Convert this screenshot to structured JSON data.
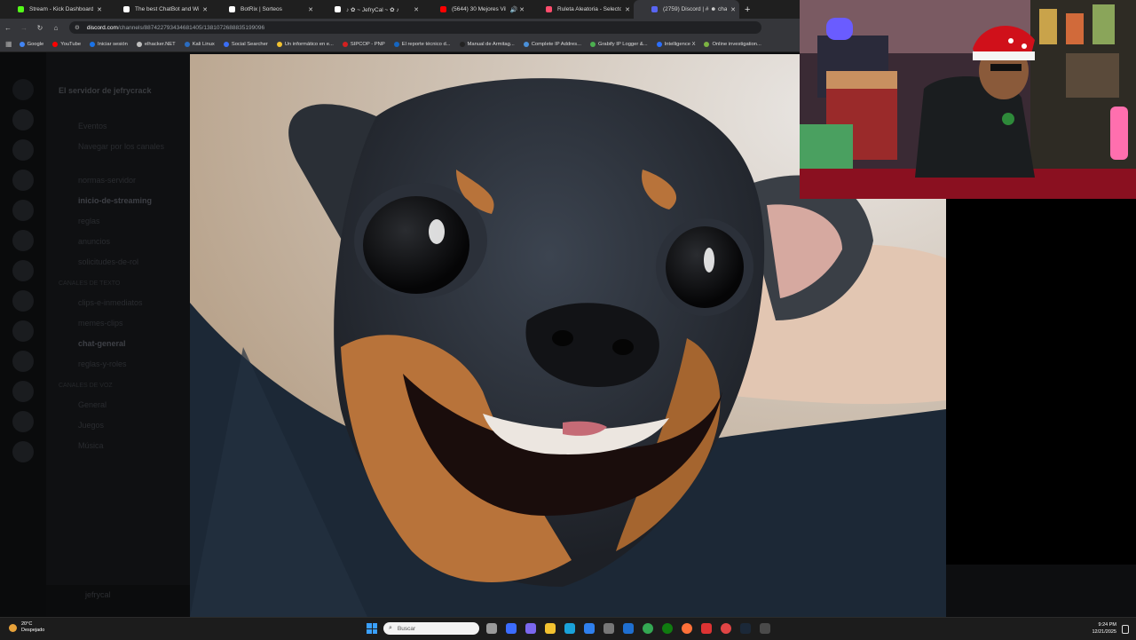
{
  "browser": {
    "tabs": [
      {
        "title": "Stream - Kick Dashboard",
        "color": "#53fc18",
        "active": false
      },
      {
        "title": "The best ChatBot and Widgets",
        "color": "#ffffff",
        "active": false
      },
      {
        "title": "BotRix | Sorteos",
        "color": "#ffffff",
        "active": false
      },
      {
        "title": "♪ ✿ ~ JefryCal ~ ✿ ♪",
        "color": "#ffffff",
        "active": false
      },
      {
        "title": "(5644) 30 Mejores Villancic",
        "color": "#ff0000",
        "active": false
      },
      {
        "title": "Ruleta Aleatoria - Selector Pers",
        "color": "#ff4d6d",
        "active": false
      },
      {
        "title": "(2759) Discord | # ☻ chat-gene",
        "color": "#5865f2",
        "active": true
      }
    ],
    "address": {
      "host": "discord.com",
      "path": "/channels/887422793434681405/1381072688835199096"
    },
    "bookmarks": [
      {
        "label": "Google",
        "color": "#4285f4"
      },
      {
        "label": "YouTube",
        "color": "#ff0000"
      },
      {
        "label": "Iniciar sesión",
        "color": "#1a73e8"
      },
      {
        "label": "elhacker.NET",
        "color": "#c0c0c0"
      },
      {
        "label": "Kali Linux",
        "color": "#2a6cc0"
      },
      {
        "label": "Social Searcher",
        "color": "#3a6ef5"
      },
      {
        "label": "Un informático en e...",
        "color": "#f2c230"
      },
      {
        "label": "SIPCOP - PNP",
        "color": "#d42020"
      },
      {
        "label": "El reporte técnico d...",
        "color": "#1565c0"
      },
      {
        "label": "Manual de Armitag...",
        "color": "#222222"
      },
      {
        "label": "Complete IP Addres...",
        "color": "#4a90d9"
      },
      {
        "label": "Grabify IP Logger &...",
        "color": "#4caf50"
      },
      {
        "label": "Intelligence X",
        "color": "#2b6fff"
      },
      {
        "label": "Online investigation...",
        "color": "#7cb342"
      }
    ]
  },
  "discord": {
    "server_name": "El servidor de jefrycrack",
    "top_items": [
      "Eventos",
      "Navegar por los canales"
    ],
    "channels_top": [
      "normas-servidor",
      "inicio-de-streaming",
      "reglas",
      "anuncios",
      "solicitudes-de-rol"
    ],
    "category_text": "CANALES DE TEXTO",
    "channels_text": [
      "clips-e-inmediatos",
      "memes-clips",
      "chat-general",
      "reglas-y-roles"
    ],
    "category_voice": "CANALES DE VOZ",
    "channels_voice": [
      "General",
      "Juegos",
      "Música"
    ],
    "user": "jefrycal"
  },
  "taskbar": {
    "weather_temp": "20°C",
    "weather_desc": "Despejado",
    "search_placeholder": "Buscar",
    "time": "9:24 PM",
    "date": "12/21/2025"
  }
}
